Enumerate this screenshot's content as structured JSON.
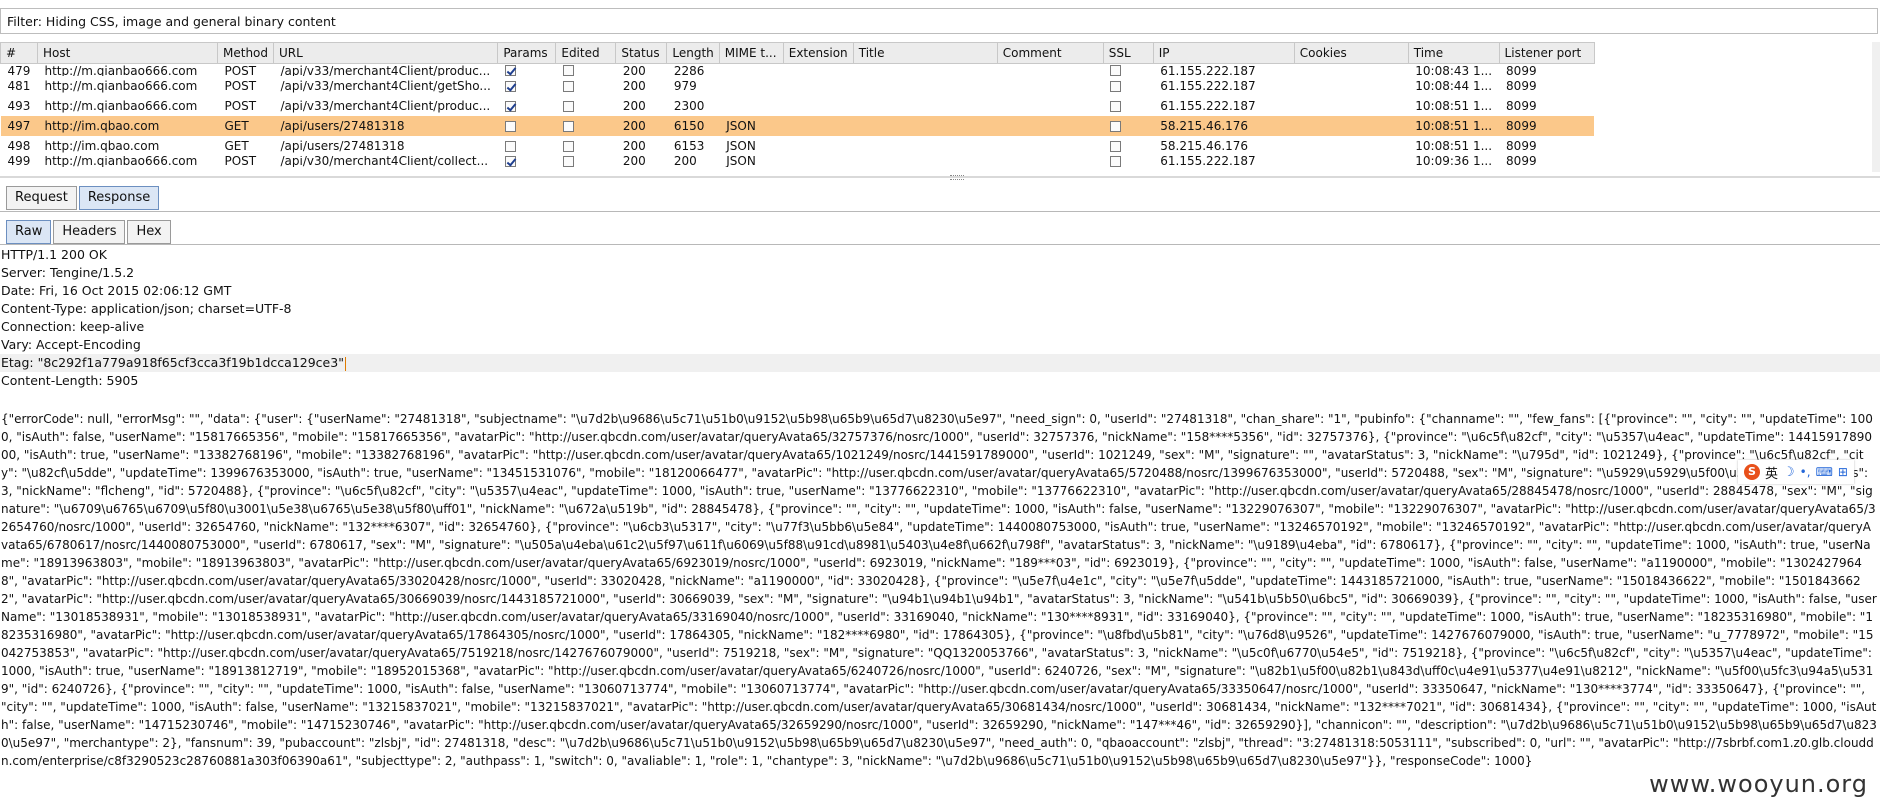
{
  "filter": {
    "text": "Filter: Hiding CSS, image and general binary content"
  },
  "table": {
    "columns": [
      "#",
      "Host",
      "Method",
      "URL",
      "Params",
      "Edited",
      "Status",
      "Length",
      "MIME t...",
      "Extension",
      "Title",
      "Comment",
      "SSL",
      "IP",
      "Cookies",
      "Time",
      "Listener port"
    ],
    "rows": [
      {
        "id": "479",
        "host": "http://m.qianbao666.com",
        "method": "POST",
        "url": "/api/v33/merchant4Client/produc...",
        "params": true,
        "edited": false,
        "status": "200",
        "length": "2286",
        "mime": "",
        "extension": "",
        "title": "",
        "comment": "",
        "ssl": false,
        "ip": "61.155.222.187",
        "cookies": "",
        "time": "10:08:43 1...",
        "port": "8099",
        "partial": "top"
      },
      {
        "id": "481",
        "host": "http://m.qianbao666.com",
        "method": "POST",
        "url": "/api/v33/merchant4Client/getSho...",
        "params": true,
        "edited": false,
        "status": "200",
        "length": "979",
        "mime": "",
        "extension": "",
        "title": "",
        "comment": "",
        "ssl": false,
        "ip": "61.155.222.187",
        "cookies": "",
        "time": "10:08:44 1...",
        "port": "8099"
      },
      {
        "id": "493",
        "host": "http://m.qianbao666.com",
        "method": "POST",
        "url": "/api/v33/merchant4Client/produc...",
        "params": true,
        "edited": false,
        "status": "200",
        "length": "2300",
        "mime": "",
        "extension": "",
        "title": "",
        "comment": "",
        "ssl": false,
        "ip": "61.155.222.187",
        "cookies": "",
        "time": "10:08:51 1...",
        "port": "8099"
      },
      {
        "id": "497",
        "host": "http://im.qbao.com",
        "method": "GET",
        "url": "/api/users/27481318",
        "params": false,
        "edited": false,
        "status": "200",
        "length": "6150",
        "mime": "JSON",
        "extension": "",
        "title": "",
        "comment": "",
        "ssl": false,
        "ip": "58.215.46.176",
        "cookies": "",
        "time": "10:08:51 1...",
        "port": "8099",
        "selected": true
      },
      {
        "id": "498",
        "host": "http://im.qbao.com",
        "method": "GET",
        "url": "/api/users/27481318",
        "params": false,
        "edited": false,
        "status": "200",
        "length": "6153",
        "mime": "JSON",
        "extension": "",
        "title": "",
        "comment": "",
        "ssl": false,
        "ip": "58.215.46.176",
        "cookies": "",
        "time": "10:08:51 1...",
        "port": "8099"
      },
      {
        "id": "499",
        "host": "http://m.qianbao666.com",
        "method": "POST",
        "url": "/api/v30/merchant4Client/collect...",
        "params": true,
        "edited": false,
        "status": "200",
        "length": "200",
        "mime": "JSON",
        "extension": "",
        "title": "",
        "comment": "",
        "ssl": false,
        "ip": "61.155.222.187",
        "cookies": "",
        "time": "10:09:36 1...",
        "port": "8099",
        "partial": "bottom"
      }
    ]
  },
  "tabs_top": [
    {
      "label": "Request",
      "active": false
    },
    {
      "label": "Response",
      "active": true
    }
  ],
  "tabs_sub": [
    {
      "label": "Raw",
      "active": true
    },
    {
      "label": "Headers",
      "active": false
    },
    {
      "label": "Hex",
      "active": false
    }
  ],
  "response": {
    "headers": [
      "HTTP/1.1 200 OK",
      "Server: Tengine/1.5.2",
      "Date: Fri, 16 Oct 2015 02:06:12 GMT",
      "Content-Type: application/json; charset=UTF-8",
      "Connection: keep-alive",
      "Vary: Accept-Encoding",
      "Etag: \"8c292f1a779a918f65cf3cca3f19b1dcca129ce3\"",
      "Content-Length: 5905"
    ],
    "body": "{\"errorCode\": null, \"errorMsg\": \"\", \"data\": {\"user\": {\"userName\": \"27481318\", \"subjectname\": \"\\u7d2b\\u9686\\u5c71\\u51b0\\u9152\\u5b98\\u65b9\\u65d7\\u8230\\u5e97\", \"need_sign\": 0, \"userId\": \"27481318\", \"chan_share\": \"1\", \"pubinfo\": {\"channame\": \"\", \"few_fans\": [{\"province\": \"\", \"city\": \"\", \"updateTime\": 1000, \"isAuth\": false, \"userName\": \"15817665356\", \"mobile\": \"15817665356\", \"avatarPic\": \"http://user.qbcdn.com/user/avatar/queryAvata65/32757376/nosrc/1000\", \"userId\": 32757376, \"nickName\": \"158****5356\", \"id\": 32757376}, {\"province\": \"\\u6c5f\\u82cf\", \"city\": \"\\u5357\\u4eac\", \"updateTime\": 1441591789000, \"isAuth\": true, \"userName\": \"13382768196\", \"mobile\": \"13382768196\", \"avatarPic\": \"http://user.qbcdn.com/user/avatar/queryAvata65/1021249/nosrc/1441591789000\", \"userId\": 1021249, \"sex\": \"M\", \"signature\": \"\", \"avatarStatus\": 3, \"nickName\": \"\\u795d\", \"id\": 1021249}, {\"province\": \"\\u6c5f\\u82cf\", \"city\": \"\\u82cf\\u5dde\", \"updateTime\": 1399676353000, \"isAuth\": true, \"userName\": \"13451531076\", \"mobile\": \"18120066477\", \"avatarPic\": \"http://user.qbcdn.com/user/avatar/queryAvata65/5720488/nosrc/1399676353000\", \"userId\": 5720488, \"sex\": \"M\", \"signature\": \"\\u5929\\u5929\\u5f00\\u5fc3\", \"avatarStatus\": 3, \"nickName\": \"flcheng\", \"id\": 5720488}, {\"province\": \"\\u6c5f\\u82cf\", \"city\": \"\\u5357\\u4eac\", \"updateTime\": 1000, \"isAuth\": true, \"userName\": \"13776622310\", \"mobile\": \"13776622310\", \"avatarPic\": \"http://user.qbcdn.com/user/avatar/queryAvata65/28845478/nosrc/1000\", \"userId\": 28845478, \"sex\": \"M\", \"signature\": \"\\u6709\\u6765\\u6709\\u5f80\\u3001\\u5e38\\u6765\\u5e38\\u5f80\\uff01\", \"nickName\": \"\\u672a\\u519b\", \"id\": 28845478}, {\"province\": \"\", \"city\": \"\", \"updateTime\": 1000, \"isAuth\": false, \"userName\": \"13229076307\", \"mobile\": \"13229076307\", \"avatarPic\": \"http://user.qbcdn.com/user/avatar/queryAvata65/32654760/nosrc/1000\", \"userId\": 32654760, \"nickName\": \"132****6307\", \"id\": 32654760}, {\"province\": \"\\u6cb3\\u5317\", \"city\": \"\\u77f3\\u5bb6\\u5e84\", \"updateTime\": 1440080753000, \"isAuth\": true, \"userName\": \"13246570192\", \"mobile\": \"13246570192\", \"avatarPic\": \"http://user.qbcdn.com/user/avatar/queryAvata65/6780617/nosrc/1440080753000\", \"userId\": 6780617, \"sex\": \"M\", \"signature\": \"\\u505a\\u4eba\\u61c2\\u5f97\\u611f\\u6069\\u5f88\\u91cd\\u8981\\u5403\\u4e8f\\u662f\\u798f\", \"avatarStatus\": 3, \"nickName\": \"\\u9189\\u4eba\", \"id\": 6780617}, {\"province\": \"\", \"city\": \"\", \"updateTime\": 1000, \"isAuth\": true, \"userName\": \"18913963803\", \"mobile\": \"18913963803\", \"avatarPic\": \"http://user.qbcdn.com/user/avatar/queryAvata65/6923019/nosrc/1000\", \"userId\": 6923019, \"nickName\": \"189***03\", \"id\": 6923019}, {\"province\": \"\", \"city\": \"\", \"updateTime\": 1000, \"isAuth\": false, \"userName\": \"a1190000\", \"mobile\": \"13024279648\", \"avatarPic\": \"http://user.qbcdn.com/user/avatar/queryAvata65/33020428/nosrc/1000\", \"userId\": 33020428, \"nickName\": \"a1190000\", \"id\": 33020428}, {\"province\": \"\\u5e7f\\u4e1c\", \"city\": \"\\u5e7f\\u5dde\", \"updateTime\": 1443185721000, \"isAuth\": true, \"userName\": \"15018436622\", \"mobile\": \"15018436622\", \"avatarPic\": \"http://user.qbcdn.com/user/avatar/queryAvata65/30669039/nosrc/1443185721000\", \"userId\": 30669039, \"sex\": \"M\", \"signature\": \"\\u94b1\\u94b1\\u94b1\", \"avatarStatus\": 3, \"nickName\": \"\\u541b\\u5b50\\u6bc5\", \"id\": 30669039}, {\"province\": \"\", \"city\": \"\", \"updateTime\": 1000, \"isAuth\": false, \"userName\": \"13018538931\", \"mobile\": \"13018538931\", \"avatarPic\": \"http://user.qbcdn.com/user/avatar/queryAvata65/33169040/nosrc/1000\", \"userId\": 33169040, \"nickName\": \"130****8931\", \"id\": 33169040}, {\"province\": \"\", \"city\": \"\", \"updateTime\": 1000, \"isAuth\": true, \"userName\": \"18235316980\", \"mobile\": \"18235316980\", \"avatarPic\": \"http://user.qbcdn.com/user/avatar/queryAvata65/17864305/nosrc/1000\", \"userId\": 17864305, \"nickName\": \"182****6980\", \"id\": 17864305}, {\"province\": \"\\u8fbd\\u5b81\", \"city\": \"\\u76d8\\u9526\", \"updateTime\": 1427676079000, \"isAuth\": true, \"userName\": \"u_7778972\", \"mobile\": \"15042753853\", \"avatarPic\": \"http://user.qbcdn.com/user/avatar/queryAvata65/7519218/nosrc/1427676079000\", \"userId\": 7519218, \"sex\": \"M\", \"signature\": \"QQ1320053766\", \"avatarStatus\": 3, \"nickName\": \"\\u5c0f\\u6770\\u54e5\", \"id\": 7519218}, {\"province\": \"\\u6c5f\\u82cf\", \"city\": \"\\u5357\\u4eac\", \"updateTime\": 1000, \"isAuth\": true, \"userName\": \"18913812719\", \"mobile\": \"18952015368\", \"avatarPic\": \"http://user.qbcdn.com/user/avatar/queryAvata65/6240726/nosrc/1000\", \"userId\": 6240726, \"sex\": \"M\", \"signature\": \"\\u82b1\\u5f00\\u82b1\\u843d\\uff0c\\u4e91\\u5377\\u4e91\\u8212\", \"nickName\": \"\\u5f00\\u5fc3\\u94a5\\u5319\", \"id\": 6240726}, {\"province\": \"\", \"city\": \"\", \"updateTime\": 1000, \"isAuth\": false, \"userName\": \"13060713774\", \"mobile\": \"13060713774\", \"avatarPic\": \"http://user.qbcdn.com/user/avatar/queryAvata65/33350647/nosrc/1000\", \"userId\": 33350647, \"nickName\": \"130****3774\", \"id\": 33350647}, {\"province\": \"\", \"city\": \"\", \"updateTime\": 1000, \"isAuth\": false, \"userName\": \"13215837021\", \"mobile\": \"13215837021\", \"avatarPic\": \"http://user.qbcdn.com/user/avatar/queryAvata65/30681434/nosrc/1000\", \"userId\": 30681434, \"nickName\": \"132****7021\", \"id\": 30681434}, {\"province\": \"\", \"city\": \"\", \"updateTime\": 1000, \"isAuth\": false, \"userName\": \"14715230746\", \"mobile\": \"14715230746\", \"avatarPic\": \"http://user.qbcdn.com/user/avatar/queryAvata65/32659290/nosrc/1000\", \"userId\": 32659290, \"nickName\": \"147***46\", \"id\": 32659290}], \"channicon\": \"\", \"description\": \"\\u7d2b\\u9686\\u5c71\\u51b0\\u9152\\u5b98\\u65b9\\u65d7\\u8230\\u5e97\", \"merchantype\": 2}, \"fansnum\": 39, \"pubaccount\": \"zlsbj\", \"id\": 27481318, \"desc\": \"\\u7d2b\\u9686\\u5c71\\u51b0\\u9152\\u5b98\\u65b9\\u65d7\\u8230\\u5e97\", \"need_auth\": 0, \"qbaoaccount\": \"zlsbj\", \"thread\": \"3:27481318:5053111\", \"subscribed\": 0, \"url\": \"\", \"avatarPic\": \"http://7sbrbf.com1.z0.glb.clouddn.com/enterprise/c8f3290523c28760881a303f06390a61\", \"subjecttype\": 2, \"authpass\": 1, \"switch\": 0, \"avaliable\": 1, \"role\": 1, \"chantype\": 3, \"nickName\": \"\\u7d2b\\u9686\\u5c71\\u51b0\\u9152\\u5b98\\u65b9\\u65d7\\u8230\\u5e97\"}}, \"responseCode\": 1000}"
  },
  "ime": {
    "s": "S",
    "lang": "英",
    "moon": "☽",
    "dot": "•,",
    "kbd": "⌨",
    "extra": "⊞"
  },
  "watermark": "www.wooyun.org",
  "colors": {
    "selected_row": "#fbc88a",
    "active_tab": "#dbe6f5"
  }
}
